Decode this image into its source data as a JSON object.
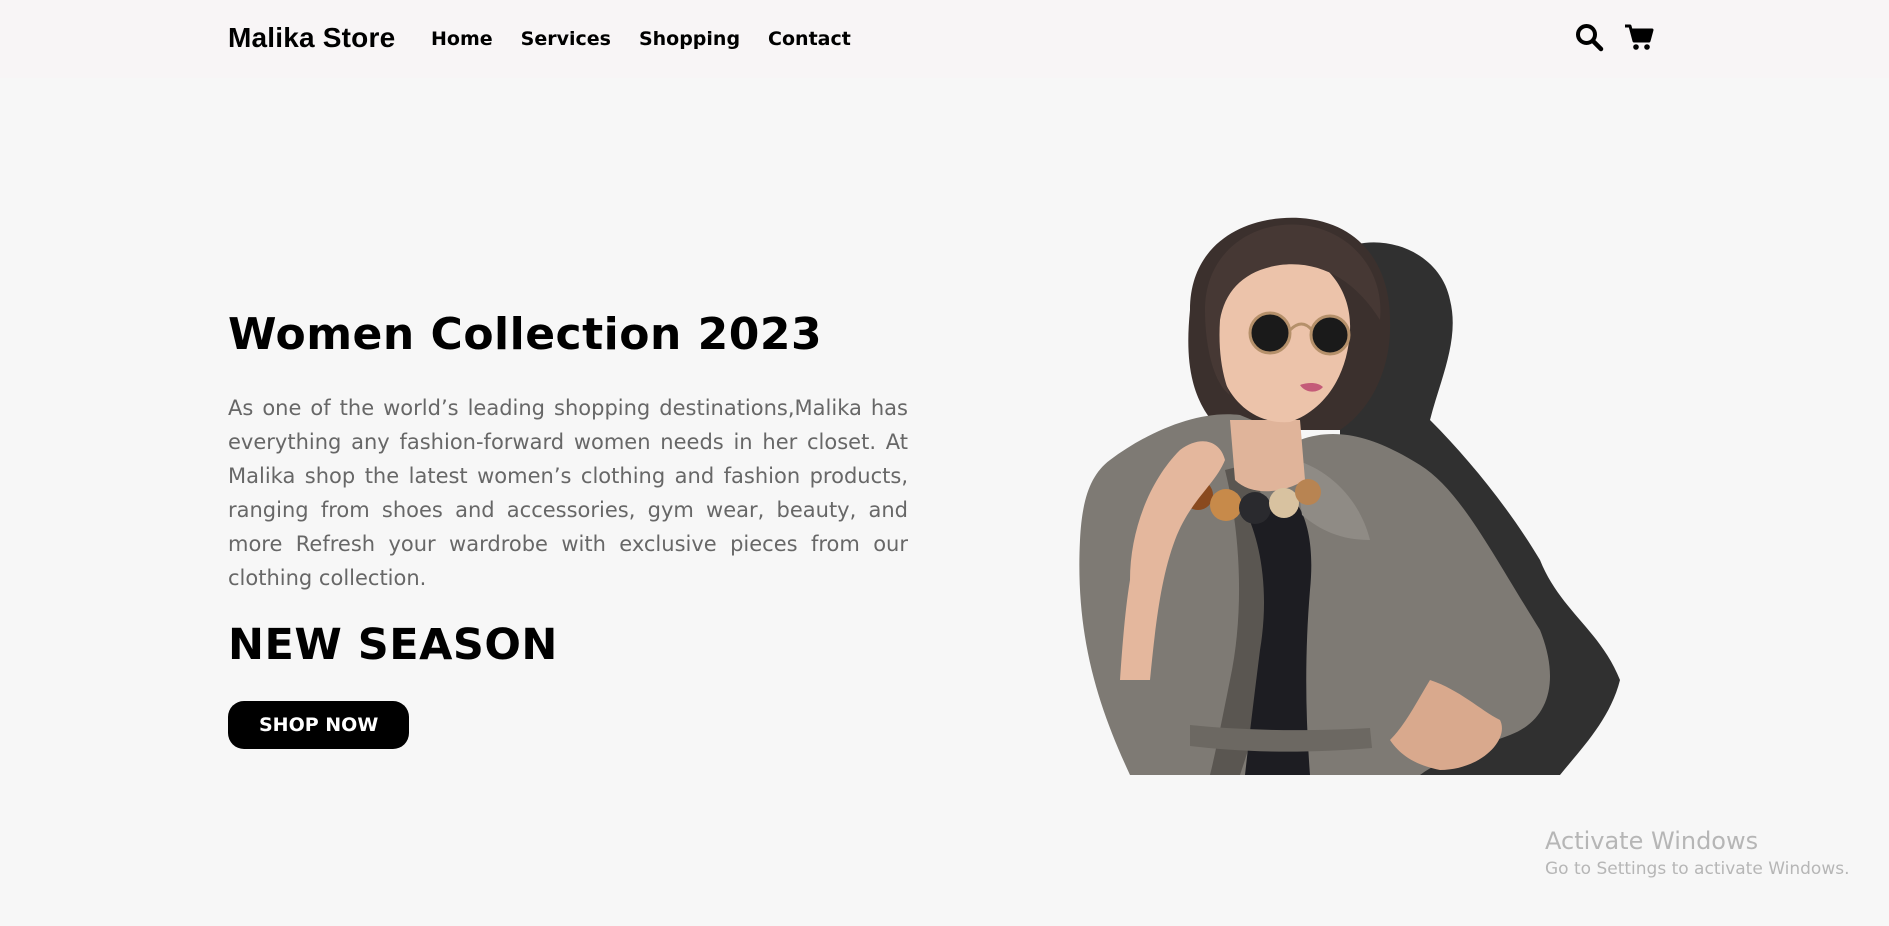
{
  "brand": {
    "name": "Malika Store"
  },
  "nav": {
    "items": [
      {
        "label": "Home"
      },
      {
        "label": "Services"
      },
      {
        "label": "Shopping"
      },
      {
        "label": "Contact"
      }
    ],
    "icons": [
      "search-icon",
      "cart-icon"
    ]
  },
  "hero": {
    "title": "Women Collection 2023",
    "description": "As one of the world’s leading shopping destinations,Malika has everything any fashion-forward women needs in her closet. At Malika shop the latest women’s clothing and fashion products, ranging from shoes and accessories, gym wear, beauty, and more Refresh your wardrobe with exclusive pieces from our clothing collection.",
    "subtitle": "NEW SEASON",
    "button_label": "SHOP NOW",
    "image_description": "woman in sunglasses and grey trench coat"
  },
  "watermark": {
    "title": "Activate Windows",
    "subtitle": "Go to Settings to activate Windows."
  },
  "colors": {
    "page_bg": "#f7f7f7",
    "nav_bg": "#f8f5f6",
    "text_primary": "#000000",
    "text_muted": "#676767",
    "button_bg": "#000000",
    "button_text": "#ffffff",
    "coat": "#7e7a74",
    "watermark": "#b6b6b6"
  }
}
